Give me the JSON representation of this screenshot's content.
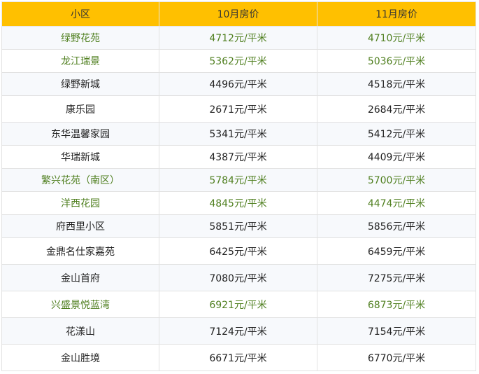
{
  "table": {
    "headers": [
      "小区",
      "10月房价",
      "11月房价"
    ],
    "rows": [
      {
        "name": "绿野花苑",
        "oct": "4712元/平米",
        "nov": "4710元/平米",
        "highlight": true
      },
      {
        "name": "龙江瑞景",
        "oct": "5362元/平米",
        "nov": "5036元/平米",
        "highlight": true
      },
      {
        "name": "绿野新城",
        "oct": "4496元/平米",
        "nov": "4518元/平米",
        "highlight": false
      },
      {
        "name": "康乐园",
        "oct": "2671元/平米",
        "nov": "2684元/平米",
        "highlight": false
      },
      {
        "name": "东华温馨家园",
        "oct": "5341元/平米",
        "nov": "5412元/平米",
        "highlight": false
      },
      {
        "name": "华瑞新城",
        "oct": "4387元/平米",
        "nov": "4409元/平米",
        "highlight": false
      },
      {
        "name": "繁兴花苑（南区）",
        "oct": "5784元/平米",
        "nov": "5700元/平米",
        "highlight": true
      },
      {
        "name": "洋西花园",
        "oct": "4845元/平米",
        "nov": "4474元/平米",
        "highlight": true
      },
      {
        "name": "府西里小区",
        "oct": "5851元/平米",
        "nov": "5856元/平米",
        "highlight": false
      },
      {
        "name": "金鼎名仕家嘉苑",
        "oct": "6425元/平米",
        "nov": "6459元/平米",
        "highlight": false
      },
      {
        "name": "金山首府",
        "oct": "7080元/平米",
        "nov": "7275元/平米",
        "highlight": false
      },
      {
        "name": "兴盛景悦蓝湾",
        "oct": "6921元/平米",
        "nov": "6873元/平米",
        "highlight": true
      },
      {
        "name": "花漾山",
        "oct": "7124元/平米",
        "nov": "7154元/平米",
        "highlight": false
      },
      {
        "name": "金山胜境",
        "oct": "6671元/平米",
        "nov": "6770元/平米",
        "highlight": false
      }
    ]
  },
  "colors": {
    "header_bg": "#ffc000",
    "highlight_text": "#4f7f1f",
    "zebra_bg": "#f7f9fc"
  }
}
